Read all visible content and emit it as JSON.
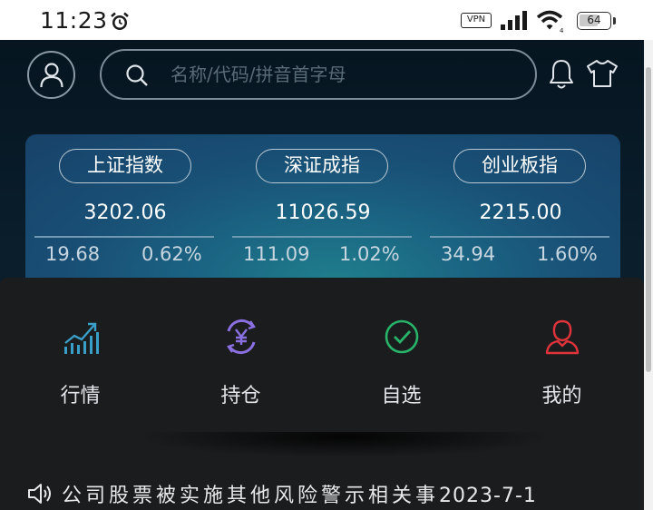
{
  "status_bar": {
    "time": "11:23",
    "alarm_icon": "alarm-clock-icon",
    "vpn": "VPN",
    "battery": "64",
    "battery_level": 0.64
  },
  "header": {
    "search_placeholder": "名称/代码/拼音首字母",
    "icons": [
      "avatar-icon",
      "search-icon",
      "bell-icon",
      "shirt-icon"
    ]
  },
  "indices": [
    {
      "name": "上证指数",
      "value": "3202.06",
      "change": "19.68",
      "percent": "0.62%"
    },
    {
      "name": "深证成指",
      "value": "11026.59",
      "change": "111.09",
      "percent": "1.02%"
    },
    {
      "name": "创业板指",
      "value": "2215.00",
      "change": "34.94",
      "percent": "1.60%"
    }
  ],
  "menu": [
    {
      "label": "行情",
      "icon": "market-chart-icon",
      "color": "#3a9fc8"
    },
    {
      "label": "持仓",
      "icon": "yuan-holdings-icon",
      "color": "#8a6fe0"
    },
    {
      "label": "自选",
      "icon": "check-circle-icon",
      "color": "#27b36a"
    },
    {
      "label": "我的",
      "icon": "user-profile-icon",
      "color": "#e0343a"
    }
  ],
  "ticker": {
    "text": "公司股票被实施其他风险警示相关事",
    "date": "2023-7-1"
  },
  "colors": {
    "app_bg": "#061520",
    "card_bg": "#1b6583",
    "panel_bg": "#1b1c1e"
  }
}
